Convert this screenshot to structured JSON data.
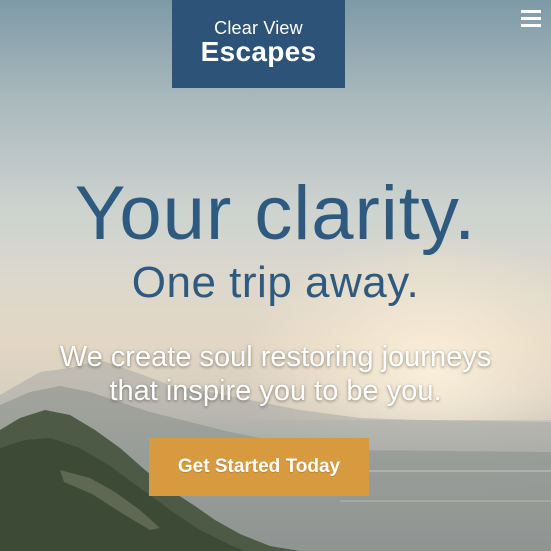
{
  "logo": {
    "line1": "Clear View",
    "line2": "Escapes"
  },
  "nav": {
    "menu_icon": "hamburger-menu-icon"
  },
  "hero": {
    "headline_1": "Your clarity.",
    "headline_2": "One trip away.",
    "tagline_line1": "We create soul restoring journeys",
    "tagline_line2": "that inspire you to be you.",
    "cta_label": "Get Started Today"
  },
  "colors": {
    "logo_background": "#2d5478",
    "headline": "#2e5a80",
    "cta_background": "#d79a3f",
    "tagline": "#ffffff"
  }
}
